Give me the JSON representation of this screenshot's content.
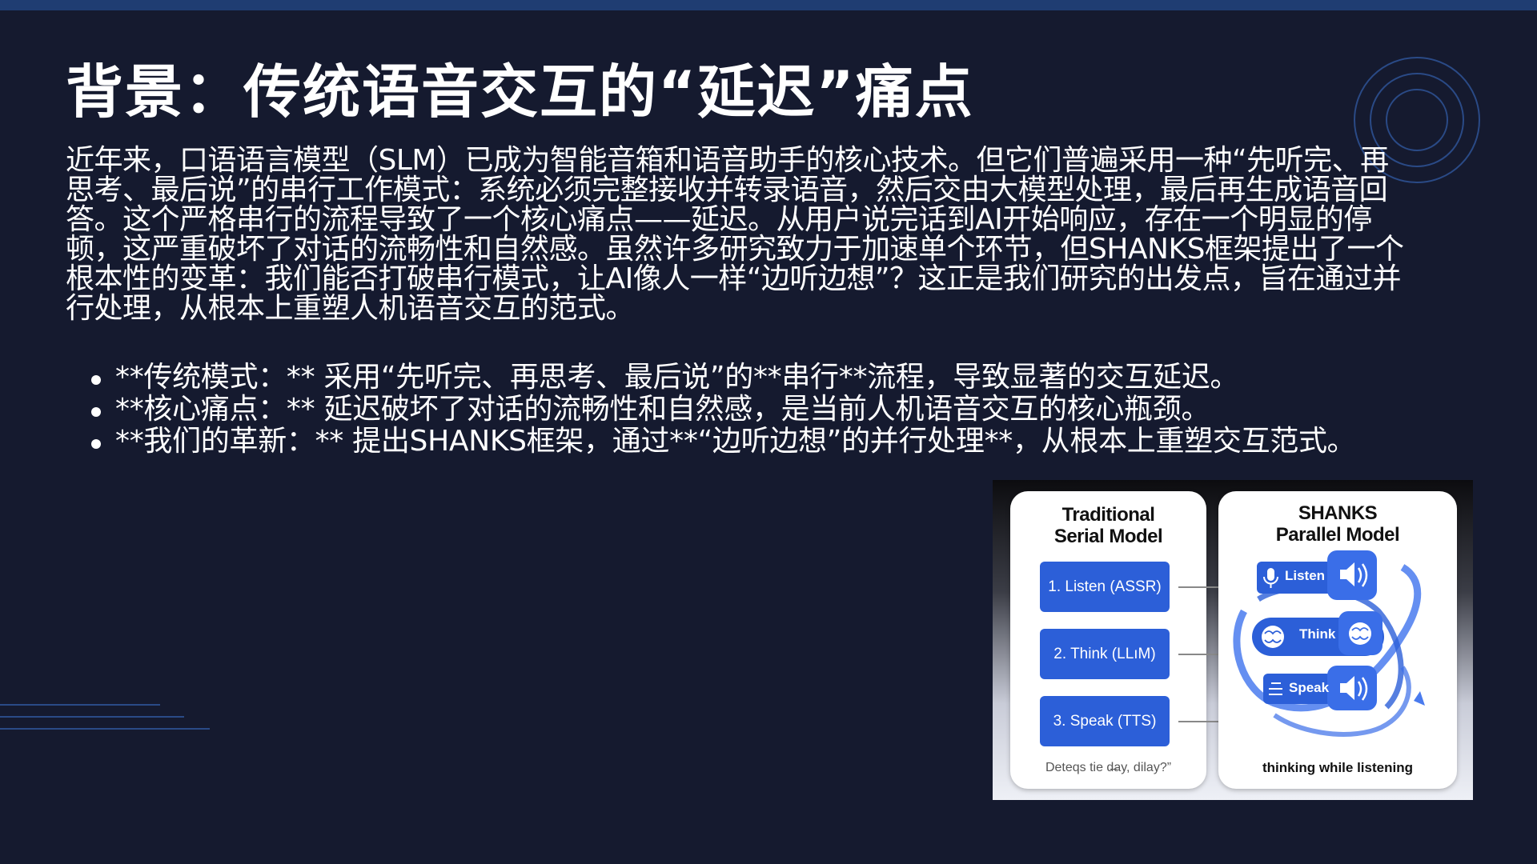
{
  "slide": {
    "title": "背景：传统语音交互的“延迟”痛点",
    "intro": "近年来，口语语言模型（SLM）已成为智能音箱和语音助手的核心技术。但它们普遍采用一种“先听完、再思考、最后说”的串行工作模式：系统必须完整接收并转录语音，然后交由大模型处理，最后再生成语音回答。这个严格串行的流程导致了一个核心痛点——延迟。从用户说完话到AI开始响应，存在一个明显的停顿，这严重破坏了对话的流畅性和自然感。虽然许多研究致力于加速单个环节，但SHANKS框架提出了一个根本性的变革：我们能否打破串行模式，让AI像人一样“边听边想”？这正是我们研究的出发点，旨在通过并行处理，从根本上重塑人机语音交互的范式。",
    "bullets": [
      "**传统模式：** 采用“先听完、再思考、最后说”的**串行**流程，导致显著的交互延迟。",
      "**核心痛点：** 延迟破坏了对话的流畅性和自然感，是当前人机语音交互的核心瓶颈。",
      "**我们的革新：** 提出SHANKS框架，通过**“边听边想”的并行处理**，从根本上重塑交互范式。"
    ]
  },
  "figure": {
    "left": {
      "title_line1": "Traditional",
      "title_line2": "Serial Model",
      "steps": [
        "1. Listen (ASSR)",
        "2. Think (LLıM)",
        "3. Speak (TTS)"
      ],
      "caption": "Deteqs tie d̶ay, dilay?”"
    },
    "right": {
      "title_line1": "SHANKS",
      "title_line2": "Parallel Model",
      "labels": [
        "Listen",
        "Think",
        "Speak"
      ],
      "caption": "thinking while listening",
      "icons": [
        "microphone-icon",
        "speaker-icon",
        "brain-icon",
        "brain-icon",
        "menu-icon",
        "speaker-icon"
      ]
    },
    "colors": {
      "step_blue": "#2c5fd8",
      "accent_blue": "#3a6ee8"
    }
  }
}
